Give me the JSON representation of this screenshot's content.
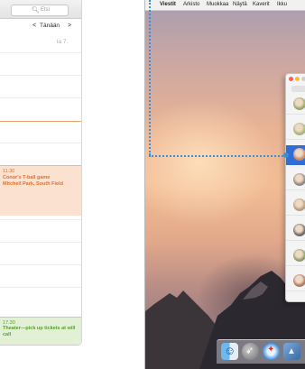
{
  "calendar": {
    "search_placeholder": "Etsi",
    "nav": {
      "prev": "<",
      "today": "Tänään",
      "next": ">"
    },
    "day_label": "la 7.",
    "events": [
      {
        "time": "11.30",
        "title": "Conor's T-ball game",
        "location": "Mitchell Park, South Field"
      },
      {
        "time": "17.30",
        "title": "Theater—pick up tickets at will call"
      }
    ],
    "colors": {
      "event1_bg": "#fbe1cf",
      "event1_text": "#e0722a",
      "event2_bg": "#e2f0d6",
      "event2_text": "#5aa02d",
      "now_line": "#f3a06a"
    }
  },
  "menubar": {
    "apple_icon": "",
    "app_name": "Viestit",
    "items": [
      "Arkisto",
      "Muokkaa",
      "Näytä",
      "Kaverit",
      "Ikku"
    ]
  },
  "messages": {
    "contacts": [
      {
        "selected": false,
        "avatar_color": "#9aa86a"
      },
      {
        "selected": false,
        "avatar_color": "#a7b67a"
      },
      {
        "selected": true,
        "avatar_color": "#c98a6a"
      },
      {
        "selected": false,
        "avatar_color": "#8f8a84"
      },
      {
        "selected": false,
        "avatar_color": "#b89d7e"
      },
      {
        "selected": false,
        "avatar_color": "#6f6a66"
      },
      {
        "selected": false,
        "avatar_color": "#8e9f6a"
      },
      {
        "selected": false,
        "avatar_color": "#b07d63"
      }
    ],
    "selected_color": "#2f6fd5"
  },
  "dock": [
    "finder-icon",
    "launchpad-icon",
    "safari-icon",
    "photo-icon"
  ],
  "callout_color": "#3a8fd8"
}
